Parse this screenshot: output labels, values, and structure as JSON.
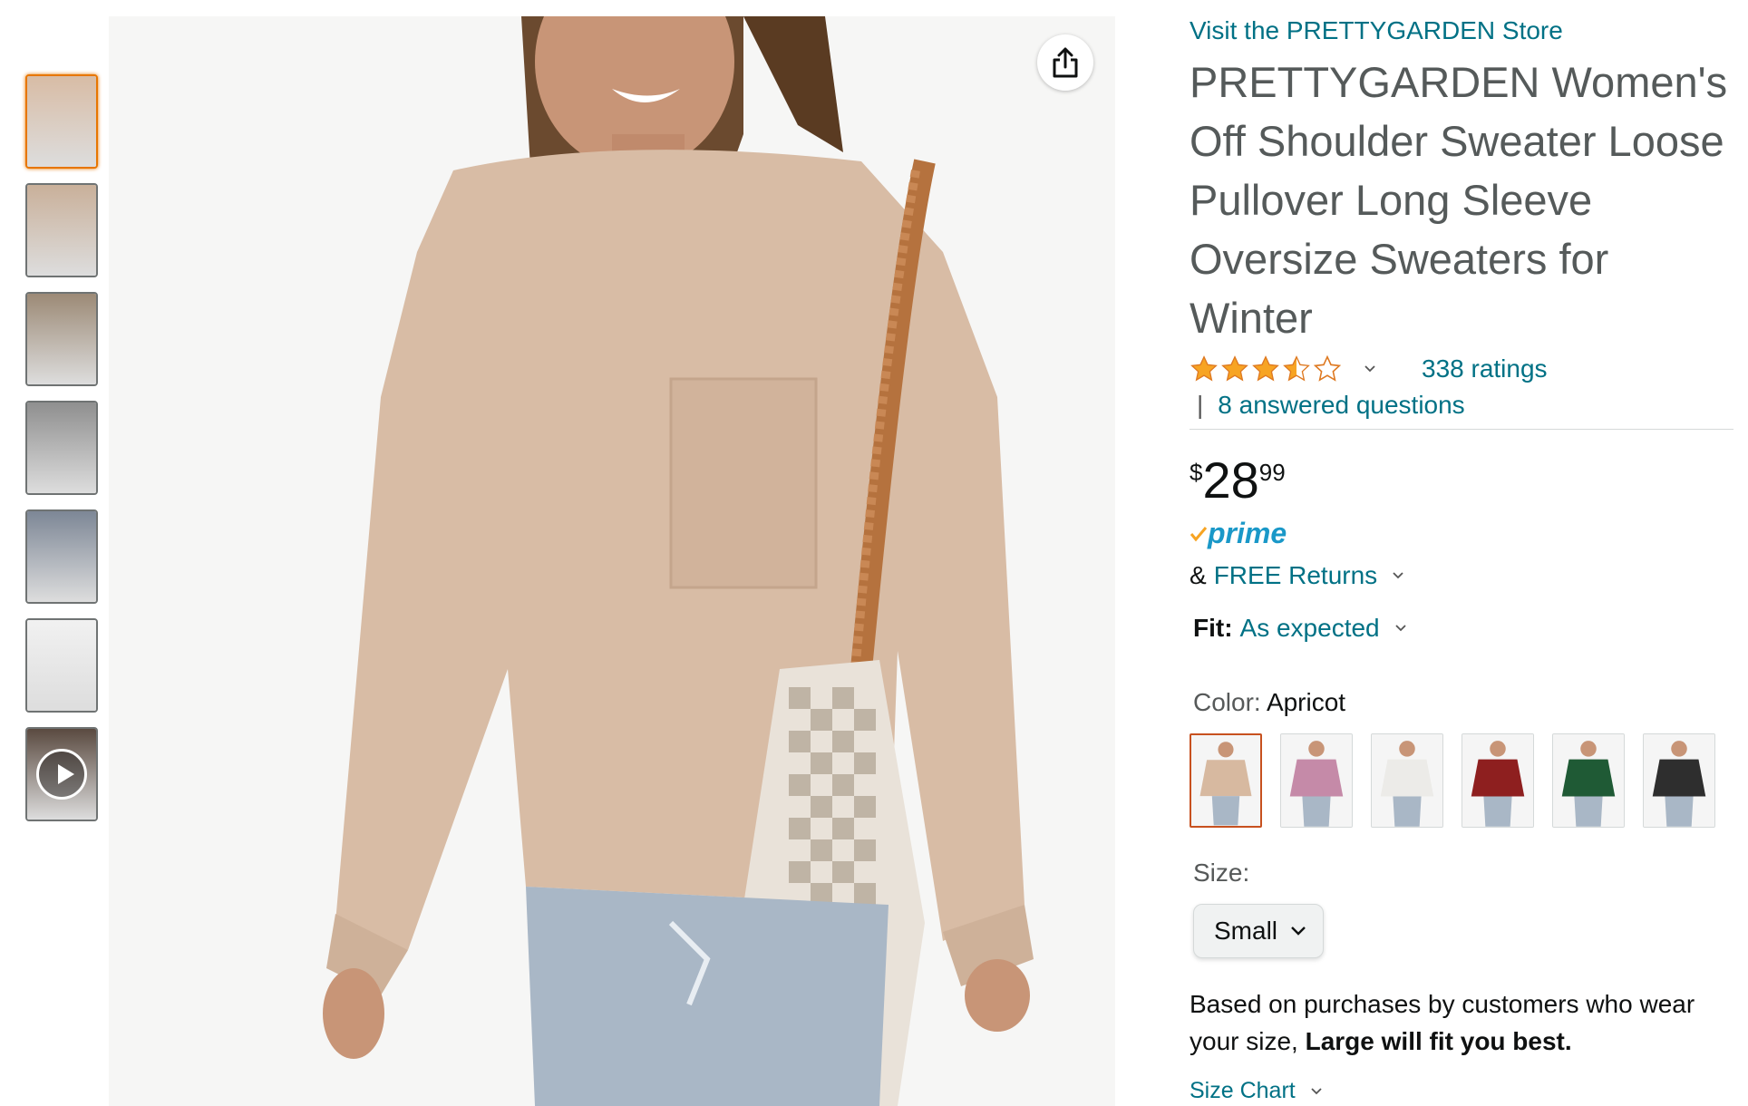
{
  "thumbnails": [
    {
      "name": "thumb-1",
      "selected": true
    },
    {
      "name": "thumb-2"
    },
    {
      "name": "thumb-3"
    },
    {
      "name": "thumb-4"
    },
    {
      "name": "thumb-5"
    },
    {
      "name": "thumb-6"
    },
    {
      "name": "thumb-video",
      "video": true
    }
  ],
  "store_link": "Visit the PRETTYGARDEN Store",
  "title": "PRETTYGARDEN Women's Off Shoulder Sweater Loose Pullover Long Sleeve Oversize Sweaters for Winter",
  "rating": {
    "stars": 3.5,
    "count_text": "338 ratings"
  },
  "questions_text": "8 answered questions",
  "qa_sep": "|",
  "price": {
    "symbol": "$",
    "whole": "28",
    "fraction": "99"
  },
  "prime_label": "prime",
  "returns": {
    "prefix": "&",
    "link": "FREE Returns"
  },
  "fit": {
    "label": "Fit:",
    "value": "As expected"
  },
  "color": {
    "label": "Color:",
    "value": "Apricot"
  },
  "swatches": [
    {
      "name": "apricot",
      "color": "#d7b9a0",
      "selected": true
    },
    {
      "name": "pink",
      "color": "#c58aa8"
    },
    {
      "name": "white",
      "color": "#ecebe8"
    },
    {
      "name": "red",
      "color": "#8e1f1f"
    },
    {
      "name": "green",
      "color": "#1f5a35"
    },
    {
      "name": "black",
      "color": "#2e2e2e"
    }
  ],
  "size": {
    "label": "Size:",
    "selected": "Small"
  },
  "fit_note": {
    "text": "Based on purchases by customers who wear your size, ",
    "bold": "Large will fit you best."
  },
  "size_chart": "Size Chart",
  "colors": {
    "link": "#007185",
    "star": "#f7a423",
    "selected_thumb": "#e77600"
  }
}
